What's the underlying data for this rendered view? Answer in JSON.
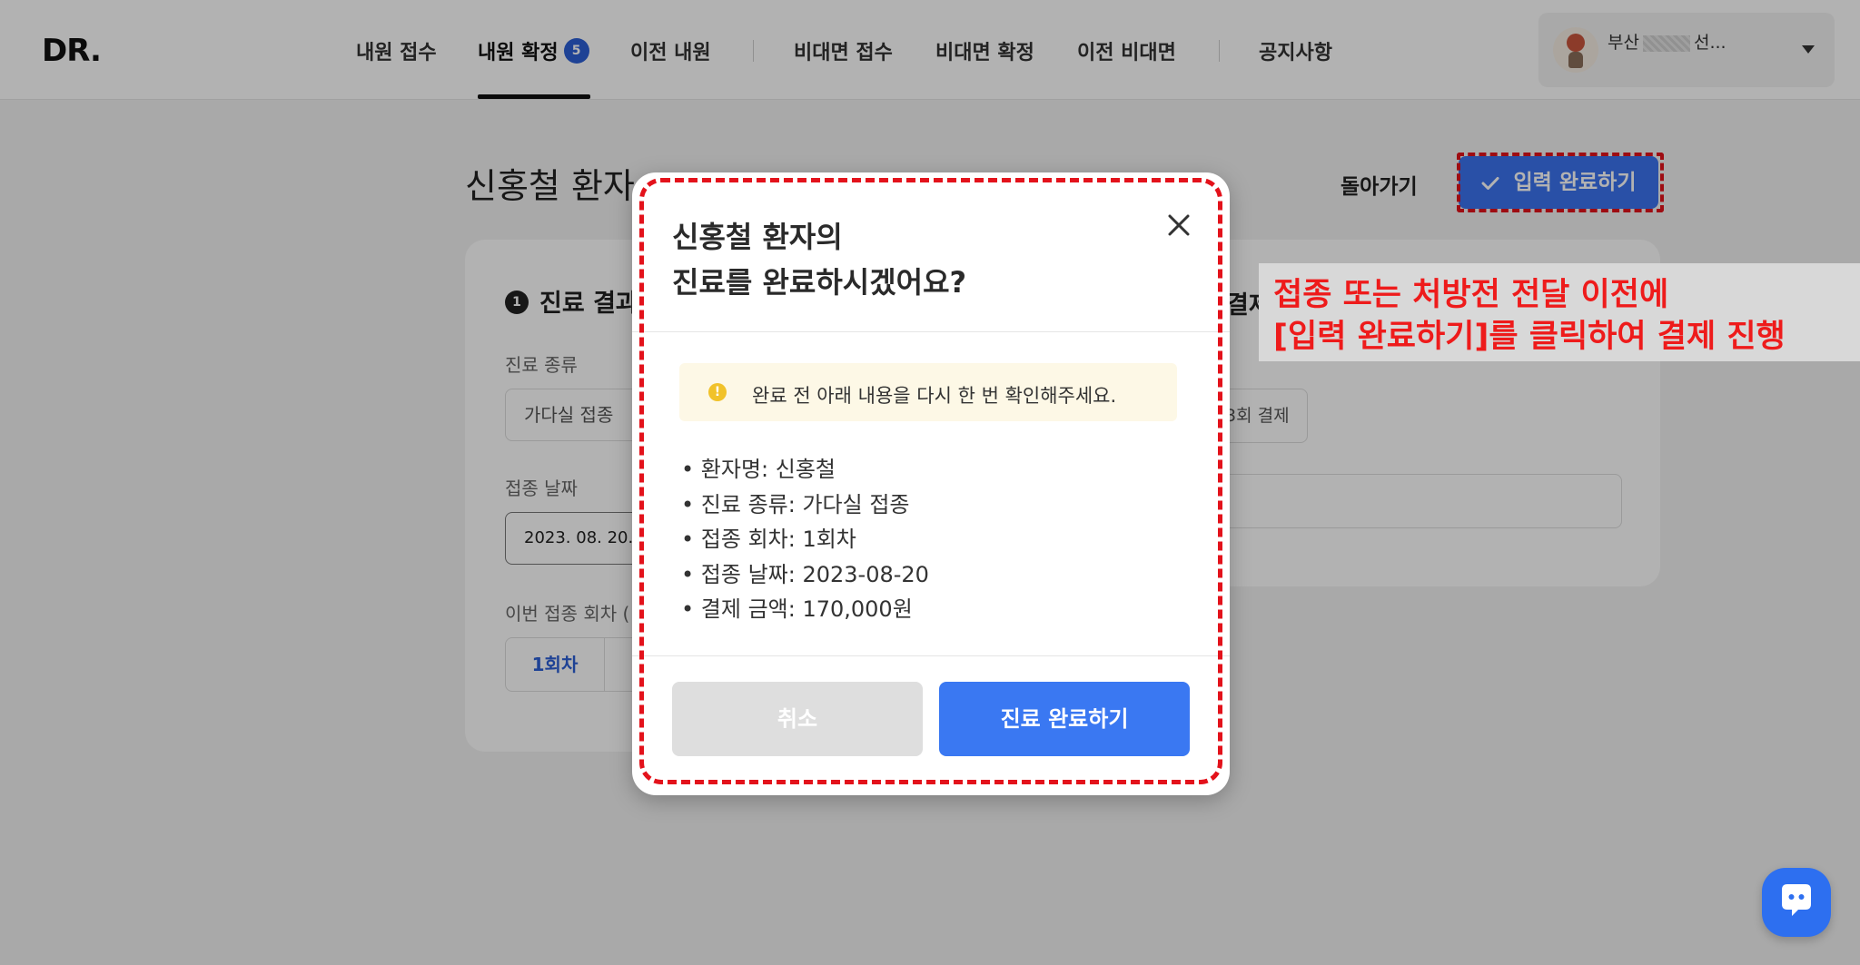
{
  "header": {
    "logo": "DR.",
    "nav": [
      {
        "label": "내원 접수"
      },
      {
        "label": "내원 확정",
        "badge": "5"
      },
      {
        "label": "이전 내원"
      },
      {
        "label": "비대면 접수"
      },
      {
        "label": "비대면 확정"
      },
      {
        "label": "이전 비대면"
      },
      {
        "label": "공지사항"
      }
    ],
    "user": {
      "name_prefix": "부산",
      "name_suffix": "선..."
    }
  },
  "page": {
    "title": "신홍철 환자",
    "back_label": "돌아가기",
    "complete_input_label": "입력 완료하기",
    "result_section": {
      "step": "1",
      "title": "진료 결과",
      "treatment_type_label": "진료 종류",
      "treatment_type_value": "가다실 접종",
      "date_label": "접종 날짜",
      "date_value": "2023. 08. 20. (",
      "round_label": "이번 접종 회차 (",
      "round_value": "1회차"
    },
    "payment_section": {
      "title": "결제",
      "chip": "3회 결제"
    }
  },
  "annotation": {
    "line1": "접종 또는 처방전 전달 이전에",
    "line2": "[입력 완료하기]를 클릭하여 결제 진행",
    "color": "#ee1b1b"
  },
  "modal": {
    "title_line1": "신홍철 환자의",
    "title_line2": "진료를 완료하시겠어요?",
    "notice": "완료 전 아래 내용을 다시 한 번 확인해주세요.",
    "summary": [
      "환자명: 신홍철",
      "진료 종류: 가다실 접종",
      "접종 회차: 1회차",
      "접종 날짜: 2023-08-20",
      "결제 금액: 170,000원"
    ],
    "cancel_label": "취소",
    "confirm_label": "진료 완료하기"
  },
  "colors": {
    "accent": "#3a78f2",
    "highlight": "#e3121b",
    "badge": "#2c5fd6"
  }
}
